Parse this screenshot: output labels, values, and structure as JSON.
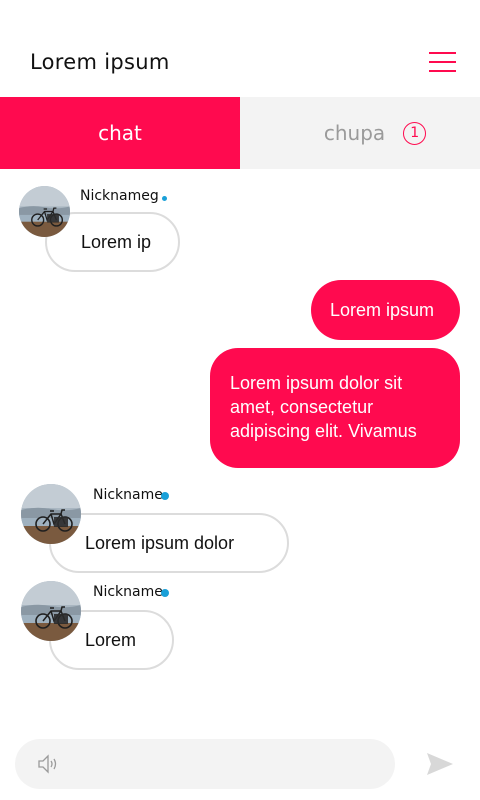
{
  "header": {
    "title": "Lorem ipsum",
    "menu_icon": "hamburger-menu-icon"
  },
  "tabs": [
    {
      "label": "chat",
      "active": true
    },
    {
      "label": "chupa",
      "active": false,
      "badge": "1"
    }
  ],
  "messages": [
    {
      "direction": "in",
      "nickname": "Nicknameg",
      "text": "Lorem ip"
    },
    {
      "direction": "out",
      "text": "Lorem ipsum"
    },
    {
      "direction": "out",
      "text": "Lorem ipsum dolor sit amet, consectetur adipiscing elit. Vivamus"
    },
    {
      "direction": "in",
      "nickname": "Nickname",
      "text": "Lorem ipsum dolor"
    },
    {
      "direction": "in",
      "nickname": "Nickname",
      "text": "Lorem"
    }
  ],
  "composer": {
    "placeholder": "",
    "mic_icon": "speaker-icon",
    "send_icon": "send-icon"
  },
  "colors": {
    "accent": "#ff0a4f",
    "online": "#1aa0d8",
    "tab_inactive_bg": "#f3f3f3",
    "bubble_border": "#dcdcdc"
  }
}
